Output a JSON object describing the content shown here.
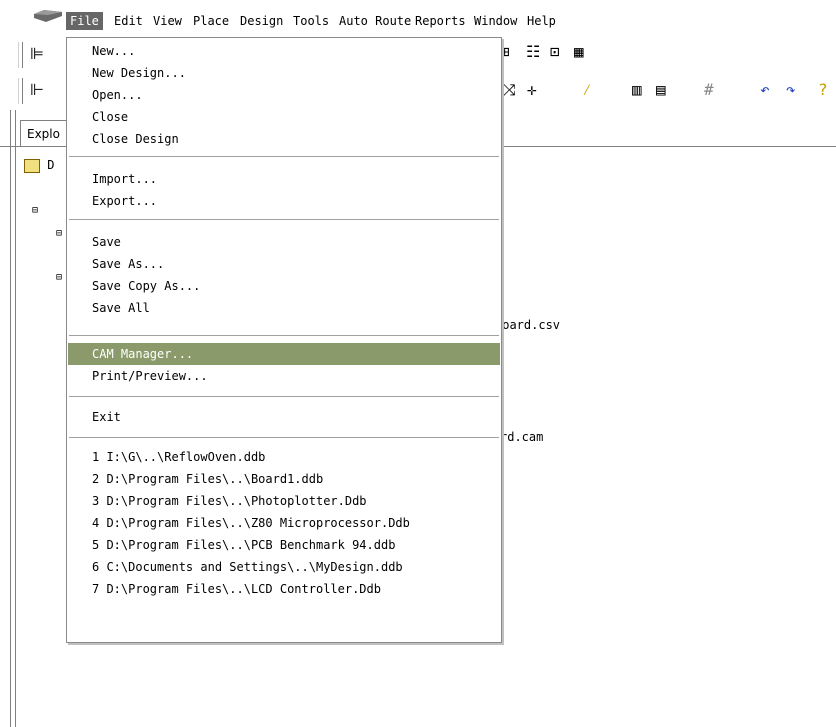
{
  "menubar": {
    "items": [
      {
        "label": "File",
        "active": true
      },
      {
        "label": "Edit"
      },
      {
        "label": "View"
      },
      {
        "label": "Place"
      },
      {
        "label": "Design"
      },
      {
        "label": "Tools"
      },
      {
        "label": "Auto Route"
      },
      {
        "label": "Reports"
      },
      {
        "label": "Window"
      },
      {
        "label": "Help"
      }
    ]
  },
  "panel": {
    "tab_label": "Explo"
  },
  "tree": {
    "root_label": "D"
  },
  "content": {
    "csv_text": "Board.csv",
    "cam_text": "rd.cam"
  },
  "file_menu": {
    "group1": [
      "New...",
      "New Design...",
      "Open...",
      "Close",
      "Close Design"
    ],
    "group2": [
      "Import...",
      "Export..."
    ],
    "group3": [
      "Save",
      "Save As...",
      "Save Copy As...",
      "Save All"
    ],
    "group4": [
      "CAM Manager...",
      "Print/Preview..."
    ],
    "group5": [
      "Exit"
    ],
    "recent": [
      "1 I:\\G\\..\\ReflowOven.ddb",
      "2 D:\\Program Files\\..\\Board1.ddb",
      "3 D:\\Program Files\\..\\Photoplotter.Ddb",
      "4 D:\\Program Files\\..\\Z80 Microprocessor.Ddb",
      "5 D:\\Program Files\\..\\PCB Benchmark 94.ddb",
      "6 C:\\Documents and Settings\\..\\MyDesign.ddb",
      "7 D:\\Program Files\\..\\LCD Controller.Ddb"
    ],
    "highlighted": "CAM Manager..."
  },
  "colors": {
    "menu_highlight": "#8a9a6a",
    "active_menu_bg": "#666666"
  }
}
